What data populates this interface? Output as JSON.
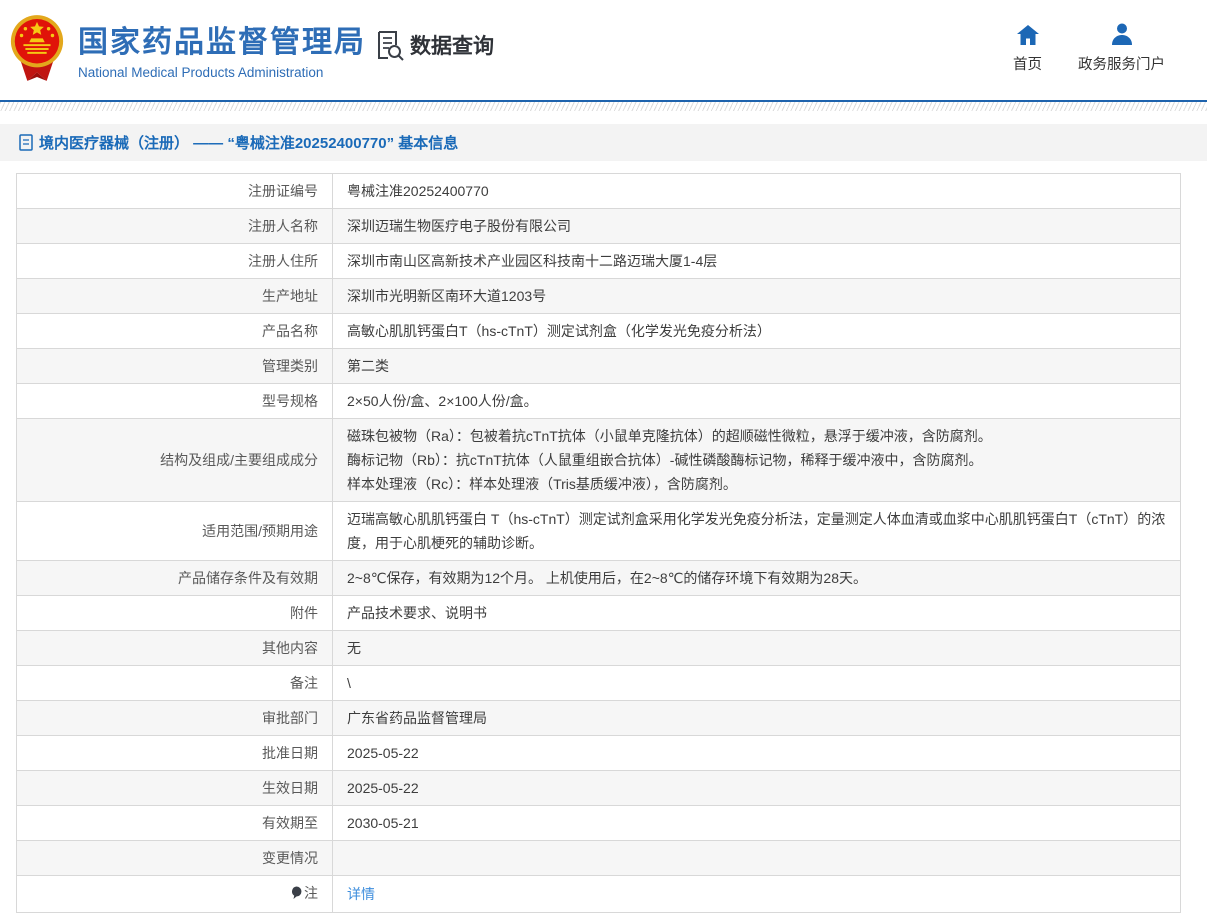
{
  "colors": {
    "brand_blue": "#2e6db6",
    "nav_icon_blue": "#1c67b5",
    "breadcrumb_blue": "#1a6ab8",
    "link_blue": "#3e8edd",
    "rule_blue": "#1e63ad",
    "band_bg": "#f3f3f3",
    "alt_row_bg": "#f6f6f6",
    "border": "#d8d8d8"
  },
  "header": {
    "title": "国家药品监督管理局",
    "subtitle": "National Medical Products Administration",
    "section_label": "数据查询",
    "nav": [
      {
        "label": "首页",
        "icon": "home-icon"
      },
      {
        "label": "政务服务门户",
        "icon": "user-icon"
      }
    ]
  },
  "breadcrumb": "境内医疗器械（注册） —— “粤械注准20252400770” 基本信息",
  "detail_table": {
    "rows": [
      {
        "label": "注册证编号",
        "value": "粤械注准20252400770"
      },
      {
        "label": "注册人名称",
        "value": "深圳迈瑞生物医疗电子股份有限公司"
      },
      {
        "label": "注册人住所",
        "value": "深圳市南山区高新技术产业园区科技南十二路迈瑞大厦1-4层"
      },
      {
        "label": "生产地址",
        "value": "深圳市光明新区南环大道1203号"
      },
      {
        "label": "产品名称",
        "value": "高敏心肌肌钙蛋白T（hs-cTnT）测定试剂盒（化学发光免疫分析法）"
      },
      {
        "label": "管理类别",
        "value": "第二类"
      },
      {
        "label": "型号规格",
        "value": "2×50人份/盒、2×100人份/盒。"
      },
      {
        "label": "结构及组成/主要组成成分",
        "lines": [
          "磁珠包被物（Ra）：包被着抗cTnT抗体（小鼠单克隆抗体）的超顺磁性微粒，悬浮于缓冲液，含防腐剂。",
          "酶标记物（Rb）：抗cTnT抗体（人鼠重组嵌合抗体）-碱性磷酸酶标记物，稀释于缓冲液中，含防腐剂。",
          "样本处理液（Rc）：样本处理液（Tris基质缓冲液），含防腐剂。"
        ]
      },
      {
        "label": "适用范围/预期用途",
        "value": "迈瑞高敏心肌肌钙蛋白 T（hs-cTnT）测定试剂盒采用化学发光免疫分析法，定量测定人体血清或血浆中心肌肌钙蛋白T（cTnT）的浓度，用于心肌梗死的辅助诊断。"
      },
      {
        "label": "产品储存条件及有效期",
        "value": "2~8℃保存，有效期为12个月。 上机使用后，在2~8℃的储存环境下有效期为28天。"
      },
      {
        "label": "附件",
        "value": "产品技术要求、说明书"
      },
      {
        "label": "其他内容",
        "value": "无"
      },
      {
        "label": "备注",
        "value": "\\"
      },
      {
        "label": "审批部门",
        "value": "广东省药品监督管理局"
      },
      {
        "label": "批准日期",
        "value": "2025-05-22"
      },
      {
        "label": "生效日期",
        "value": "2025-05-22"
      },
      {
        "label": "有效期至",
        "value": "2030-05-21"
      },
      {
        "label": "变更情况",
        "value": ""
      },
      {
        "label": "注",
        "label_icon": "hint-icon",
        "link": "详情"
      }
    ]
  }
}
